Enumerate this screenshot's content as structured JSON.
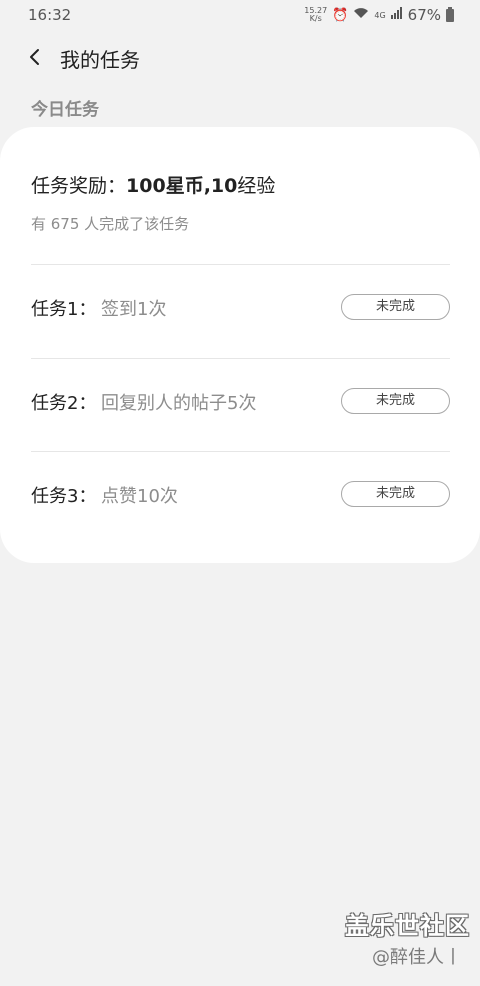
{
  "status_bar": {
    "time": "16:32",
    "net_speed_value": "15.27",
    "net_speed_unit": "K/s",
    "battery": "67%",
    "network": "4G"
  },
  "header": {
    "title": "我的任务"
  },
  "section": {
    "title": "今日任务"
  },
  "card": {
    "reward_prefix": "任务奖励：",
    "reward_coins": "100",
    "reward_coins_unit": "星币,",
    "reward_exp": "10",
    "reward_exp_unit": "经验",
    "completed_count": "有 675 人完成了该任务"
  },
  "tasks": [
    {
      "label": "任务1：",
      "desc": "签到1次",
      "status": "未完成"
    },
    {
      "label": "任务2：",
      "desc": "回复别人的帖子5次",
      "status": "未完成"
    },
    {
      "label": "任务3：",
      "desc": "点赞10次",
      "status": "未完成"
    }
  ],
  "watermark": {
    "brand": "盖乐世社区",
    "user": "@醉佳人丨"
  }
}
